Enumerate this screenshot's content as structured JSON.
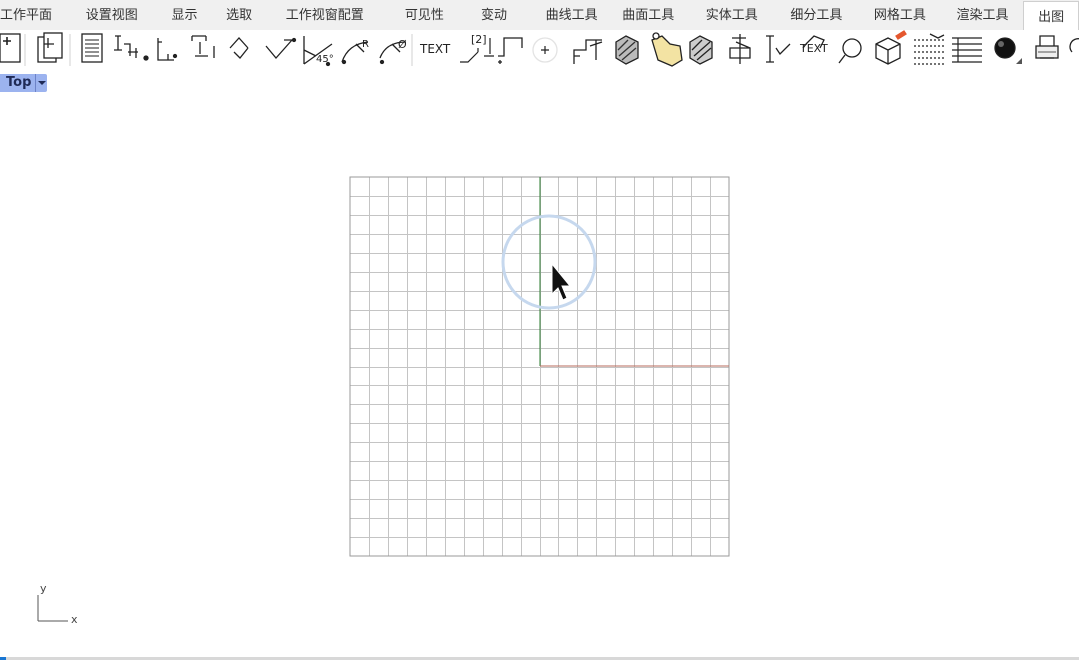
{
  "tabs": [
    {
      "label": "工作平面"
    },
    {
      "label": "设置视图"
    },
    {
      "label": "显示"
    },
    {
      "label": "选取"
    },
    {
      "label": "工作视窗配置"
    },
    {
      "label": "可见性"
    },
    {
      "label": "变动"
    },
    {
      "label": "曲线工具"
    },
    {
      "label": "曲面工具"
    },
    {
      "label": "实体工具"
    },
    {
      "label": "细分工具"
    },
    {
      "label": "网格工具"
    },
    {
      "label": "渲染工具"
    },
    {
      "label": "出图"
    }
  ],
  "active_tab": "出图",
  "toolbar": {
    "icons": [
      "new-layout-icon",
      "copy-layout-icon",
      "page-setup-icon",
      "linear-dimension-icon",
      "aligned-dimension-icon",
      "rotated-dimension-icon",
      "angle-dimension-icon",
      "arc-length-dimension-icon",
      "angle-45-dimension-icon",
      "radius-dimension-icon",
      "diameter-dimension-icon",
      "text-icon",
      "leader-icon",
      "detail-view-icon",
      "point-icon",
      "ordinate-dimension-icon",
      "hatch-icon",
      "hatch-boundary-icon",
      "hatch-remove-icon",
      "center-mark-icon",
      "dimension-check-icon",
      "text-block-icon",
      "text-search-icon",
      "make-2d-icon",
      "layout-list-icon",
      "table-icon",
      "render-sphere-icon",
      "print-icon",
      "zoom-icon"
    ],
    "text_labels": {
      "text": "TEXT",
      "detail": "[2]",
      "angle45": "45°",
      "radius": "R",
      "diameter": "Ø",
      "text_block": "TEXT"
    }
  },
  "viewport": {
    "name": "Top",
    "axis": {
      "x_label": "x",
      "y_label": "y"
    },
    "colors": {
      "grid": "#c4c4c4",
      "grid_border": "#9a9a9a",
      "y_axis": "#2e7d32",
      "x_axis": "#b76b5e",
      "cursor_ring": "#c6d8ee",
      "label_bg": "#9cb3ef"
    }
  }
}
